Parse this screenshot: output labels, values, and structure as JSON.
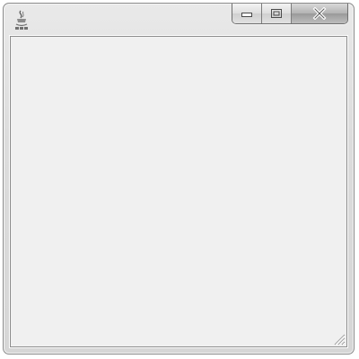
{
  "window": {
    "title": "",
    "app_icon": "java-duke-icon",
    "caption_buttons": [
      "minimize-icon",
      "maximize-icon",
      "close-icon"
    ],
    "size_grip": "resize-grip-icon"
  },
  "colors": {
    "frame": "#dcdcdc",
    "client_area": "#f0f0f0",
    "close_button": "#a8a8a8"
  }
}
